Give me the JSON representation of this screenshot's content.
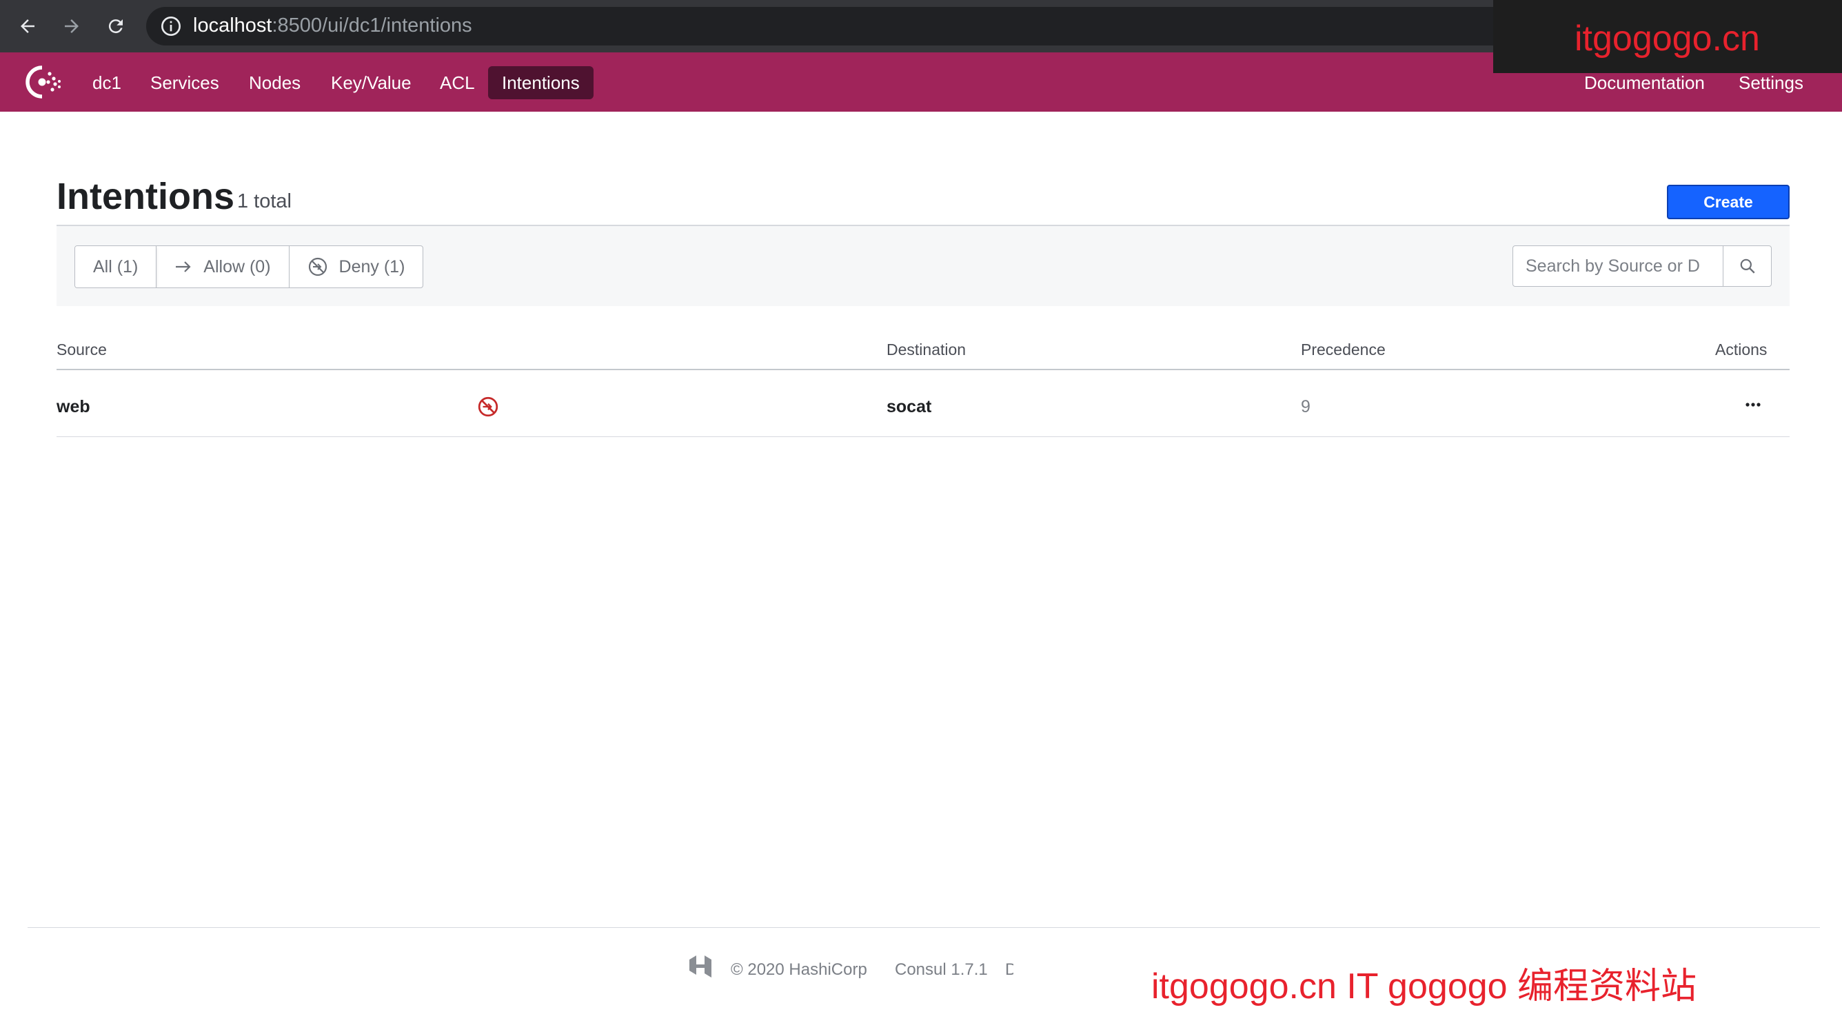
{
  "browser": {
    "url_host": "localhost",
    "url_path": ":8500/ui/dc1/intentions"
  },
  "watermarks": {
    "top": "itgogogo.cn",
    "bottom": "itgogogo.cn IT gogogo 编程资料站"
  },
  "nav": {
    "datacenter": "dc1",
    "items": [
      {
        "label": "Services"
      },
      {
        "label": "Nodes"
      },
      {
        "label": "Key/Value"
      },
      {
        "label": "ACL"
      },
      {
        "label": "Intentions",
        "active": true
      }
    ],
    "right_items": [
      {
        "label": "Documentation"
      },
      {
        "label": "Settings"
      }
    ]
  },
  "page": {
    "title": "Intentions",
    "count": "1 total",
    "create_label": "Create"
  },
  "filters": {
    "all": "All (1)",
    "allow": "Allow (0)",
    "deny": "Deny (1)"
  },
  "search": {
    "placeholder": "Search by Source or D"
  },
  "table": {
    "headers": {
      "source": "Source",
      "destination": "Destination",
      "precedence": "Precedence",
      "actions": "Actions"
    },
    "rows": [
      {
        "source": "web",
        "action": "deny",
        "destination": "socat",
        "precedence": "9"
      }
    ]
  },
  "footer": {
    "copyright": "© 2020 HashiCorp",
    "version": "Consul 1.7.1",
    "docs_fragment": "D"
  },
  "colors": {
    "brand": "#a0245a",
    "brand_active": "#4f1230",
    "primary_button": "#1563ff",
    "deny": "#c62a2a",
    "watermark": "#e8222d"
  }
}
